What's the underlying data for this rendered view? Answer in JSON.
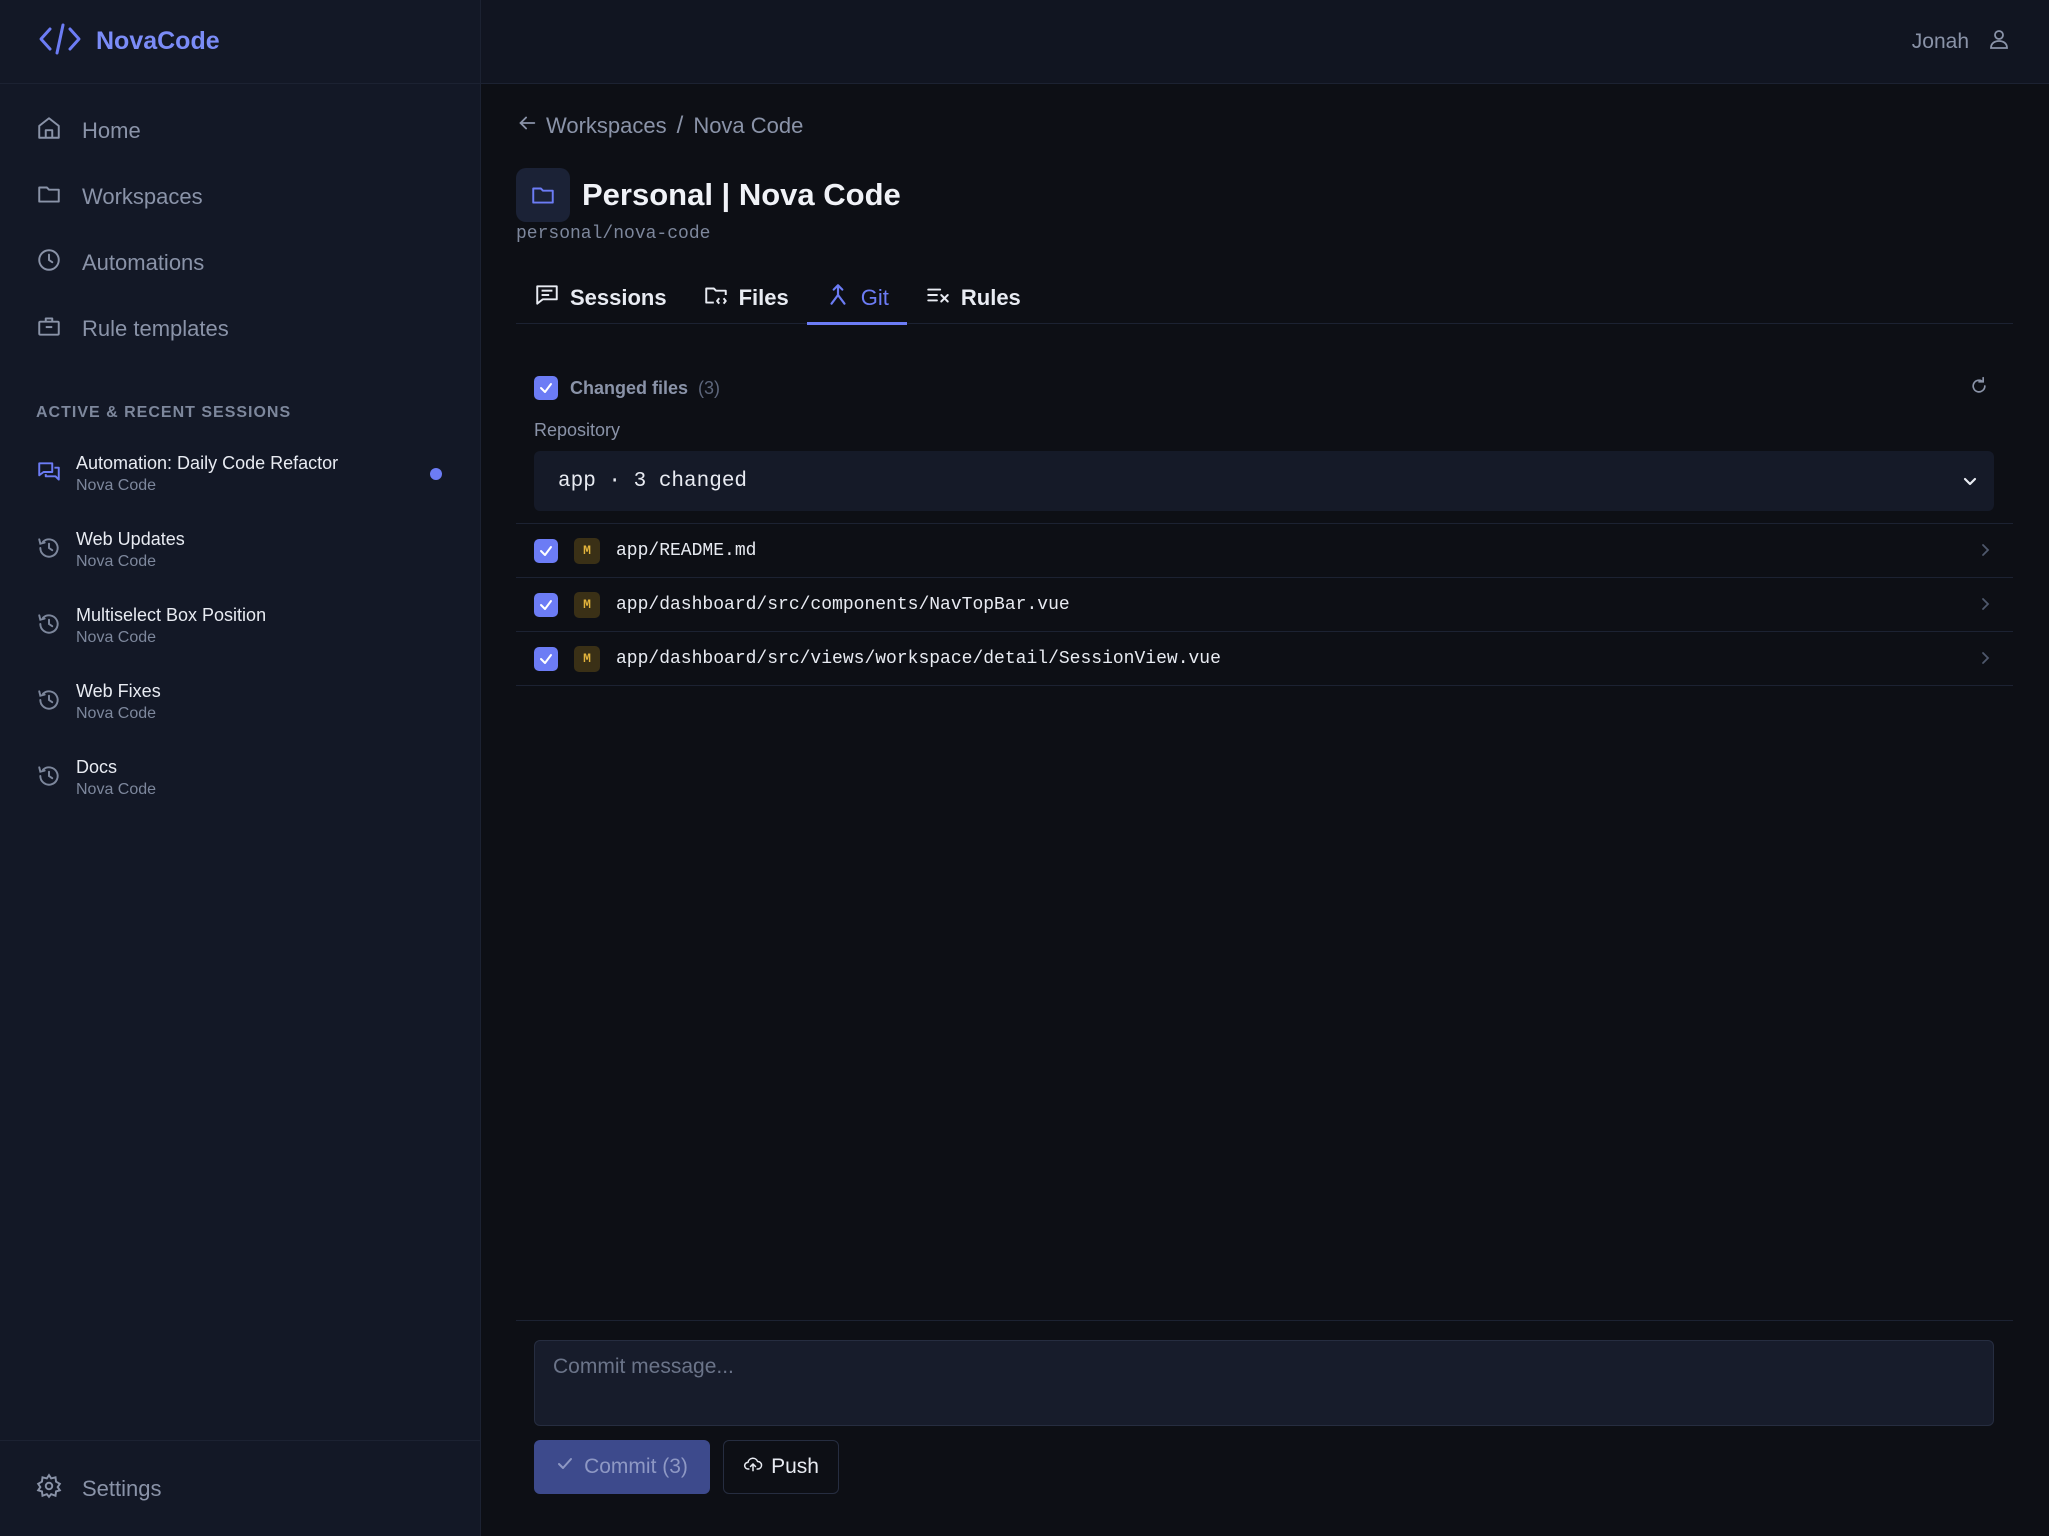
{
  "brand": {
    "name": "NovaCode",
    "icon": "code-brackets-icon"
  },
  "user": {
    "name": "Jonah",
    "icon": "user-icon"
  },
  "nav": [
    {
      "label": "Home",
      "icon": "home-icon"
    },
    {
      "label": "Workspaces",
      "icon": "folder-icon"
    },
    {
      "label": "Automations",
      "icon": "clock-icon"
    },
    {
      "label": "Rule templates",
      "icon": "briefcase-icon"
    }
  ],
  "sessions": {
    "label": "ACTIVE & RECENT SESSIONS",
    "items": [
      {
        "title": "Automation: Daily Code Refactor",
        "subtitle": "Nova Code",
        "icon": "chat-icon",
        "active": true
      },
      {
        "title": "Web Updates",
        "subtitle": "Nova Code",
        "icon": "history-icon"
      },
      {
        "title": "Multiselect Box Position",
        "subtitle": "Nova Code",
        "icon": "history-icon"
      },
      {
        "title": "Web Fixes",
        "subtitle": "Nova Code",
        "icon": "history-icon"
      },
      {
        "title": "Docs",
        "subtitle": "Nova Code",
        "icon": "history-icon"
      }
    ]
  },
  "settings": {
    "label": "Settings",
    "icon": "gear-icon"
  },
  "breadcrumb": {
    "parent": "Workspaces",
    "separator": "/",
    "current": "Nova Code"
  },
  "page": {
    "title": "Personal | Nova Code",
    "slug": "personal/nova-code"
  },
  "tabs": [
    {
      "label": "Sessions",
      "icon": "chat-icon"
    },
    {
      "label": "Files",
      "icon": "folder-code-icon"
    },
    {
      "label": "Git",
      "icon": "git-merge-icon",
      "active": true
    },
    {
      "label": "Rules",
      "icon": "list-x-icon"
    }
  ],
  "git": {
    "changed_label": "Changed files",
    "changed_count": "(3)",
    "repo_label": "Repository",
    "repo_value": "app · 3 changed",
    "files": [
      {
        "status": "M",
        "path": "app/README.md"
      },
      {
        "status": "M",
        "path": "app/dashboard/src/components/NavTopBar.vue"
      },
      {
        "status": "M",
        "path": "app/dashboard/src/views/workspace/detail/SessionView.vue"
      }
    ],
    "commit_placeholder": "Commit message...",
    "commit_label": "Commit (3)",
    "push_label": "Push"
  },
  "colors": {
    "accent": "#6c7cf5",
    "background": "#0d0f15",
    "sidebar": "#131826",
    "modified": "#e3b43c"
  }
}
